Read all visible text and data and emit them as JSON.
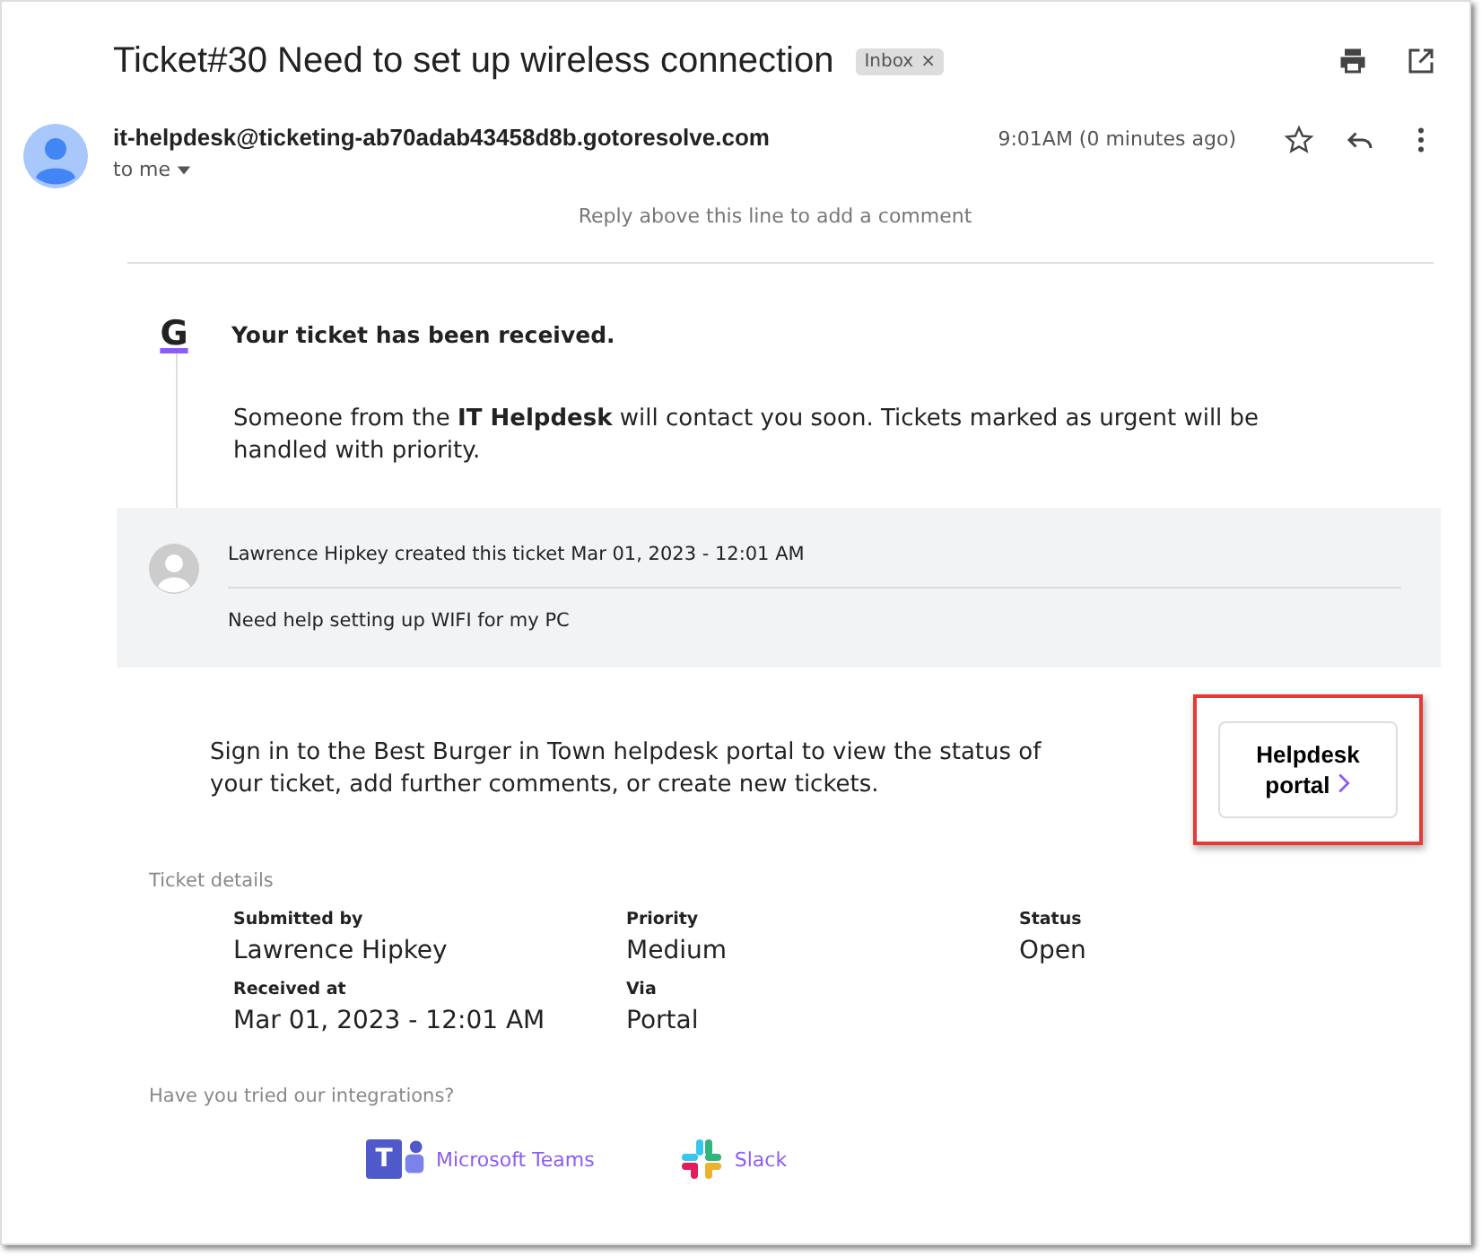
{
  "subject": "Ticket#30 Need to set up wireless connection",
  "label": {
    "text": "Inbox",
    "remove": "×"
  },
  "sender": {
    "email": "it-helpdesk@ticketing-ab70adab43458d8b.gotoresolve.com",
    "to": "to me",
    "time": "9:01AM (0 minutes ago)",
    "starred": false
  },
  "reply_hint": "Reply above this line to add a comment",
  "logo_letter": "G",
  "heading": "Your ticket has been received.",
  "message": "Someone from the **IT Helpdesk** will contact you soon. Tickets marked as urgent will be handled with priority.",
  "comment": {
    "byline": "Lawrence Hipkey created this ticket Mar 01, 2023 - 12:01 AM",
    "body": "Need help setting up WIFI for my PC"
  },
  "portal": {
    "text": "Sign in to the Best Burger in Town helpdesk portal to view the status of your ticket, add further comments, or create new tickets.",
    "button": "Helpdesk portal",
    "highlighted": true
  },
  "details": {
    "title": "Ticket details",
    "fields": [
      {
        "label": "Submitted by",
        "value": "Lawrence Hipkey"
      },
      {
        "label": "Priority",
        "value": "Medium"
      },
      {
        "label": "Status",
        "value": "Open"
      },
      {
        "label": "Received at",
        "value": "Mar 01, 2023 - 12:01 AM"
      },
      {
        "label": "Via",
        "value": "Portal"
      }
    ]
  },
  "integrations": {
    "title": "Have you tried our integrations?",
    "items": [
      {
        "kind": "teams",
        "name": "Microsoft Teams",
        "icon_letter": "T"
      },
      {
        "kind": "slack",
        "name": "Slack"
      }
    ]
  }
}
